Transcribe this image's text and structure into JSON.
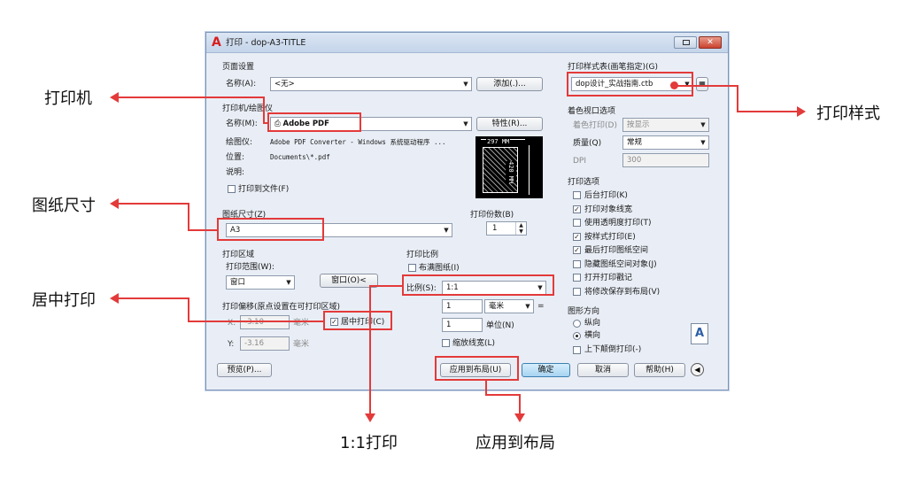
{
  "window": {
    "title": "打印 - dop-A3-TITLE"
  },
  "page_setup": {
    "section": "页面设置",
    "name_label": "名称(A):",
    "name_value": "<无>",
    "add_button": "添加(.)..."
  },
  "printer": {
    "section": "打印机/绘图仪",
    "name_label": "名称(M):",
    "name_value": "Adobe PDF",
    "properties_button": "特性(R)...",
    "plotter_label": "绘图仪:",
    "plotter_value": "Adobe PDF Converter - Windows 系统驱动程序 ...",
    "location_label": "位置:",
    "location_value": "Documents\\*.pdf",
    "description_label": "说明:",
    "print_to_file": "打印到文件(F)",
    "preview_width": "297 MM",
    "preview_height": "420 MM"
  },
  "paper_size": {
    "section": "图纸尺寸(Z)",
    "value": "A3"
  },
  "copies": {
    "label": "打印份数(B)",
    "value": "1"
  },
  "plot_area": {
    "section": "打印区域",
    "range_label": "打印范围(W):",
    "range_value": "窗口",
    "window_button": "窗口(O)<"
  },
  "plot_offset": {
    "section": "打印偏移(原点设置在可打印区域)",
    "x_label": "X:",
    "x_value": "-3.10",
    "x_unit": "毫米",
    "y_label": "Y:",
    "y_value": "-3.16",
    "y_unit": "毫米",
    "center_plot": "居中打印(C)"
  },
  "plot_scale": {
    "section": "打印比例",
    "fit_to_paper": "布满图纸(I)",
    "scale_label": "比例(S):",
    "scale_value": "1:1",
    "value1": "1",
    "unit_value": "毫米",
    "eq": "=",
    "value2": "1",
    "unit2": "单位(N)",
    "scale_lineweights": "缩放线宽(L)"
  },
  "plot_style": {
    "section": "打印样式表(画笔指定)(G)",
    "value": "dop设计_实战指南.ctb"
  },
  "shaded_viewport": {
    "section": "着色视口选项",
    "shade_label": "着色打印(D)",
    "shade_value": "按显示",
    "quality_label": "质量(Q)",
    "quality_value": "常规",
    "dpi_label": "DPI",
    "dpi_value": "300"
  },
  "plot_options": {
    "section": "打印选项",
    "items": [
      {
        "label": "后台打印(K)",
        "checked": false
      },
      {
        "label": "打印对象线宽",
        "checked": true
      },
      {
        "label": "使用透明度打印(T)",
        "checked": false
      },
      {
        "label": "按样式打印(E)",
        "checked": true
      },
      {
        "label": "最后打印图纸空间",
        "checked": true
      },
      {
        "label": "隐藏图纸空间对象(J)",
        "checked": false
      },
      {
        "label": "打开打印戳记",
        "checked": false
      },
      {
        "label": "将修改保存到布局(V)",
        "checked": false
      }
    ]
  },
  "orientation": {
    "section": "图形方向",
    "portrait": "纵向",
    "landscape": "横向",
    "upside_down": "上下颠倒打印(-)",
    "icon_letter": "A"
  },
  "buttons": {
    "preview": "预览(P)...",
    "apply_layout": "应用到布局(U)",
    "ok": "确定",
    "cancel": "取消",
    "help": "帮助(H)"
  },
  "annotations": {
    "printer": "打印机",
    "paper_size": "图纸尺寸",
    "center_plot": "居中打印",
    "plot_style": "打印样式",
    "scale_1to1": "1:1打印",
    "apply_layout": "应用到布局"
  },
  "colors": {
    "annotation_red": "#e33a3a",
    "dialog_bg": "#e9eef6",
    "ok_button": "#bfe0f7"
  }
}
